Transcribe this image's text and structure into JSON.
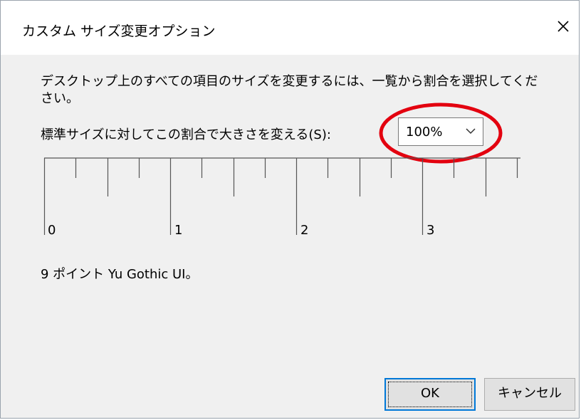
{
  "dialog": {
    "title": "カスタム サイズ変更オプション",
    "instruction": "デスクトップ上のすべての項目のサイズを変更するには、一覧から割合を選択してください。",
    "scale_label": "標準サイズに対してこの割合で大きさを変える(S):",
    "scale_value": "100%",
    "ruler_numbers": [
      "0",
      "1",
      "2",
      "3"
    ],
    "font_info": "9 ポイント Yu Gothic UI。",
    "ok_label": "OK",
    "cancel_label": "キャンセル"
  },
  "colors": {
    "highlight": "#e3000f",
    "focus_border": "#0078d7"
  },
  "icons": {
    "close": "close-icon",
    "dropdown": "chevron-down-icon"
  }
}
